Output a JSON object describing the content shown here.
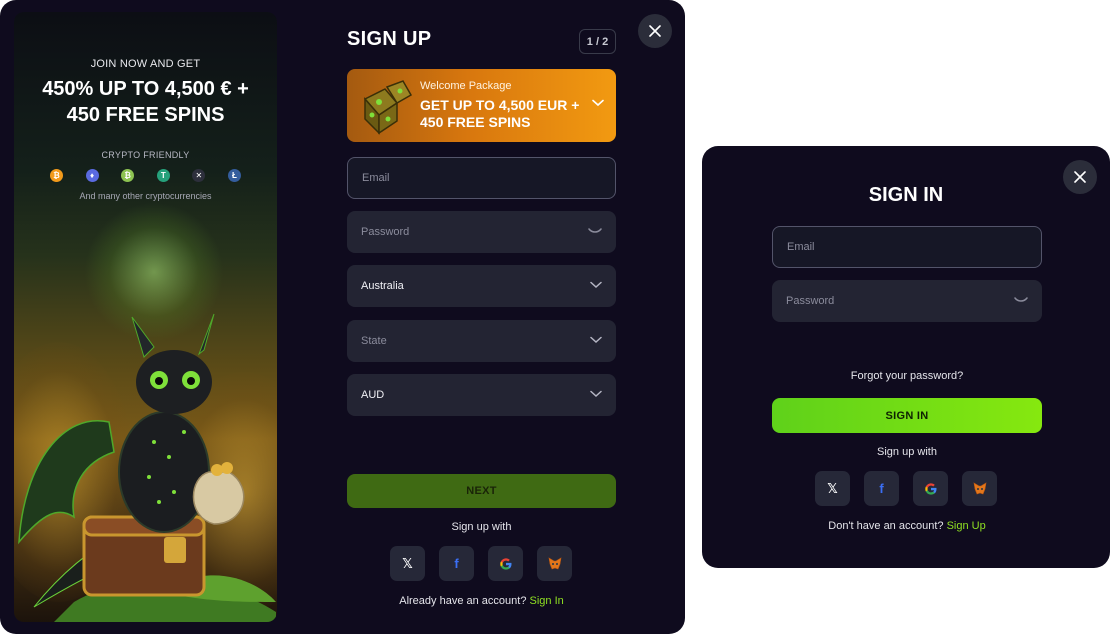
{
  "signup": {
    "promo": {
      "join_text": "JOIN NOW AND GET",
      "headline": "450% UP TO 4,500 € + 450 FREE SPINS",
      "crypto_label": "CRYPTO FRIENDLY",
      "crypto_icons": [
        "bitcoin-icon",
        "ethereum-icon",
        "bitcoin-cash-icon",
        "tether-icon",
        "ripple-icon",
        "litecoin-icon"
      ],
      "more_text": "And many other cryptocurrencies"
    },
    "title": "SIGN UP",
    "step": "1 / 2",
    "welcome": {
      "small": "Welcome Package",
      "big": "GET UP TO 4,500 EUR + 450 FREE SPINS"
    },
    "fields": {
      "email_placeholder": "Email",
      "password_placeholder": "Password",
      "country_value": "Australia",
      "state_placeholder": "State",
      "currency_value": "AUD"
    },
    "next_label": "NEXT",
    "social_label": "Sign up with",
    "account_prompt": "Already have an account?",
    "account_link": "Sign In"
  },
  "signin": {
    "title": "SIGN IN",
    "email_placeholder": "Email",
    "password_placeholder": "Password",
    "forgot": "Forgot your password?",
    "button_label": "SIGN IN",
    "social_label": "Sign up with",
    "account_prompt": "Don't have an account?",
    "account_link": "Sign Up"
  },
  "social": {
    "x": "𝕏",
    "facebook": "f"
  },
  "colors": {
    "modal_bg": "#0f0b1e",
    "field_bg": "#232433",
    "accent_green": "#86e80f",
    "next_green": "#3f6a13",
    "banner_orange": "#f29a11"
  }
}
